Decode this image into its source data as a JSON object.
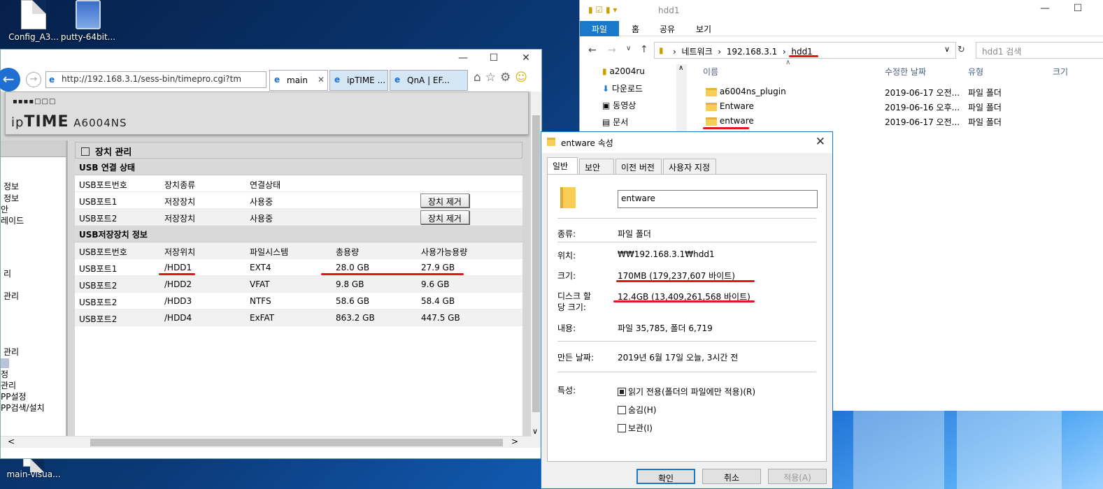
{
  "desktop": {
    "icons": [
      {
        "label": "Config_A3...",
        "icon": "document-icon"
      },
      {
        "label": "putty-64bit...",
        "icon": "putty-installer-icon"
      },
      {
        "label": "main-visua...",
        "icon": "image-icon"
      }
    ]
  },
  "ie": {
    "url": "http://192.168.3.1/sess-bin/timepro.cgi?tm",
    "tabs": [
      {
        "label": "main",
        "active": true
      },
      {
        "label": "ipTIME ..."
      },
      {
        "label": "QnA | EF..."
      }
    ],
    "header": {
      "brand_prefix": "ip",
      "brand_bold": "TIME",
      "model": "A6004NS"
    },
    "left_nav": [
      "정보",
      "정보",
      "안",
      "레이드",
      "리",
      "관리",
      "관리",
      "정",
      "관리",
      "PP설정",
      "PP검색/설치"
    ],
    "page_title": "장치 관리",
    "usb_status": {
      "title": "USB 연결 상태",
      "headers": [
        "USB포트번호",
        "장치종류",
        "연결상태"
      ],
      "rows": [
        {
          "port": "USB포트1",
          "type": "저장장치",
          "state": "사용중",
          "button": "장치 제거"
        },
        {
          "port": "USB포트2",
          "type": "저장장치",
          "state": "사용중",
          "button": "장치 제거"
        }
      ]
    },
    "storage_info": {
      "title": "USB저장장치 정보",
      "headers": [
        "USB포트번호",
        "저장위치",
        "파일시스템",
        "총용량",
        "사용가능용량"
      ],
      "rows": [
        {
          "port": "USB포트1",
          "location": "/HDD1",
          "fs": "EXT4",
          "total": "28.0 GB",
          "free": "27.9 GB"
        },
        {
          "port": "USB포트2",
          "location": "/HDD2",
          "fs": "VFAT",
          "total": "9.8 GB",
          "free": "9.6 GB"
        },
        {
          "port": "USB포트2",
          "location": "/HDD3",
          "fs": "NTFS",
          "total": "58.6 GB",
          "free": "58.4 GB"
        },
        {
          "port": "USB포트2",
          "location": "/HDD4",
          "fs": "ExFAT",
          "total": "863.2 GB",
          "free": "447.5 GB"
        }
      ]
    }
  },
  "explorer": {
    "title": "hdd1",
    "ribbon_tabs": [
      "파일",
      "홈",
      "공유",
      "보기"
    ],
    "breadcrumb": [
      "네트워크",
      "192.168.3.1",
      "hdd1"
    ],
    "search_placeholder": "hdd1 검색",
    "tree": [
      "a2004ru",
      "다운로드",
      "동영상",
      "문서"
    ],
    "columns": [
      "이름",
      "수정한 날짜",
      "유형",
      "크기"
    ],
    "files": [
      {
        "name": "a6004ns_plugin",
        "date": "2019-06-17 오전...",
        "type": "파일 폴더"
      },
      {
        "name": "Entware",
        "date": "2019-06-16 오후...",
        "type": "파일 폴더"
      },
      {
        "name": "entware",
        "date": "2019-06-17 오전...",
        "type": "파일 폴더"
      }
    ]
  },
  "properties": {
    "title": "entware 속성",
    "tabs": [
      "일반",
      "보안",
      "이전 버전",
      "사용자 지정"
    ],
    "name": "entware",
    "type_label": "종류:",
    "type_value": "파일 폴더",
    "location_label": "위치:",
    "location_value": "₩₩192.168.3.1₩hdd1",
    "size_label": "크기:",
    "size_value": "170MB (179,237,607 바이트)",
    "disk_label_1": "디스크 할",
    "disk_label_2": "당 크기:",
    "disk_value": "12.4GB (13,409,261,568 바이트)",
    "contents_label": "내용:",
    "contents_value": "파일 35,785, 폴더 6,719",
    "created_label": "만든 날짜:",
    "created_value": "2019년 6월 17일 오늘, 3시간 전",
    "attr_label": "특성:",
    "attr_readonly": "읽기 전용(폴더의 파일에만 적용)(R)",
    "attr_hidden": "숨김(H)",
    "attr_archive": "보관(I)",
    "btn_ok": "확인",
    "btn_cancel": "취소",
    "btn_apply": "적용(A)"
  },
  "colors": {
    "accent": "#1979ca",
    "annotation_red": "#e3161b",
    "ie_back": "#1e6fd0"
  }
}
